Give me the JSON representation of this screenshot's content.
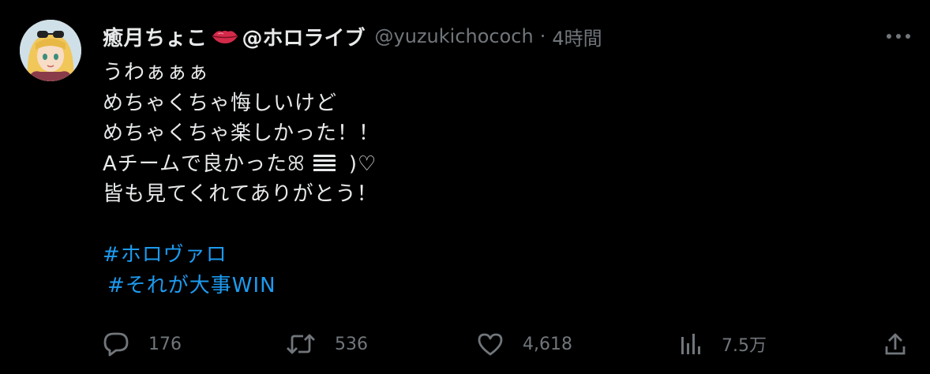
{
  "tweet": {
    "display_name": "癒月ちょこ",
    "affiliation": "@ホロライブ",
    "handle": "@yuzukichococh",
    "separator": "·",
    "time": "4時間",
    "lines": [
      "うわぁぁぁ",
      "めちゃくちゃ悔しいけど",
      "めちゃくちゃ楽しかった！！",
      "Aチームで良かったꕤ",
      " )♡",
      "皆も見てくれてありがとう！"
    ],
    "hashtags": [
      "#ホロヴァロ",
      "#それが大事WIN"
    ]
  },
  "actions": {
    "replies": "176",
    "retweets": "536",
    "likes": "4,618",
    "views": "7.5万"
  },
  "colors": {
    "background": "#000000",
    "text": "#e7e9ea",
    "muted": "#71767b",
    "link": "#1d9bf0",
    "lips": "#d42b4a"
  },
  "icons": [
    "more-icon",
    "lips-emoji",
    "reply-icon",
    "retweet-icon",
    "like-icon",
    "views-icon",
    "share-icon"
  ]
}
